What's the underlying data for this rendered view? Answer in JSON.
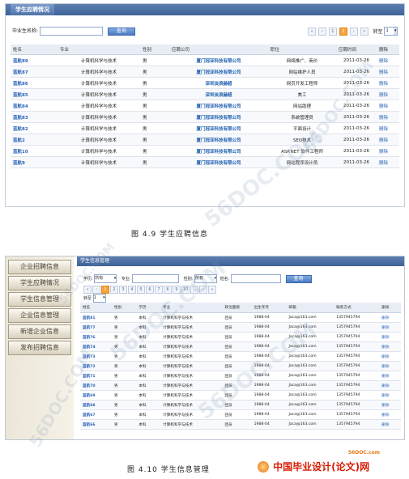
{
  "panel1": {
    "title": "学生应聘情况",
    "search_label": "毕业生名称:",
    "search_button": "查询",
    "pager": {
      "first": "«",
      "prev": "‹",
      "pages": [
        "1",
        "2"
      ],
      "current": "2",
      "next": "›",
      "last": "»",
      "goto_label": "转至",
      "goto_value": "1"
    },
    "columns": [
      "姓名",
      "专业",
      "性别",
      "应聘公司",
      "职位",
      "应聘时间",
      "删除"
    ],
    "rows": [
      [
        "蓝航89",
        "计算机科学与技术",
        "男",
        "厦门冠亚科技有限公司",
        "网络推广、商价",
        "2011-03-26",
        "删除"
      ],
      [
        "蓝航87",
        "计算机科学与技术",
        "男",
        "厦门冠亚科技有限公司",
        "网站维护人员",
        "2011-03-26",
        "删除"
      ],
      [
        "蓝航86",
        "计算机科学与技术",
        "男",
        "深圳淡浪赫超",
        "网页开发工程师",
        "2011-03-26",
        "删除"
      ],
      [
        "蓝航85",
        "计算机科学与技术",
        "男",
        "深圳淡浪赫超",
        "美工",
        "2011-03-26",
        "删除"
      ],
      [
        "蓝航84",
        "计算机科学与技术",
        "男",
        "厦门冠亚科技有限公司",
        "网站助理",
        "2011-03-26",
        "删除"
      ],
      [
        "蓝航83",
        "计算机科学与技术",
        "男",
        "厦门冠亚科技有限公司",
        "系统管理员",
        "2011-03-26",
        "删除"
      ],
      [
        "蓝航82",
        "计算机科学与技术",
        "男",
        "厦门冠亚科技有限公司",
        "平面设计",
        "2011-03-26",
        "删除"
      ],
      [
        "蓝航2",
        "计算机科学与技术",
        "男",
        "厦门冠亚科技有限公司",
        "SEO技术",
        "2011-03-26",
        "删除"
      ],
      [
        "蓝航10",
        "计算机科学与技术",
        "男",
        "厦门冠亚科技有限公司",
        "ASP.NET 软件工程师",
        "2011-03-26",
        "删除"
      ],
      [
        "蓝航9",
        "计算机科学与技术",
        "男",
        "厦门冠亚科技有限公司",
        "网站程序设计员",
        "2011-03-26",
        "删除"
      ]
    ]
  },
  "caption1": "图  4.9   学生应聘信息",
  "panel2": {
    "sidebar": [
      "企业招聘信息",
      "学生应聘情况",
      "学生信息管理",
      "企业信息管理",
      "新增企业信息",
      "发布招聘信息"
    ],
    "title": "学生信息管理",
    "filters": {
      "edu_label": "学历:",
      "edu_value": "所有",
      "major_label": "专业:",
      "gender_label": "性别:",
      "gender_value": "所有",
      "name_label": "姓名:",
      "search_button": "查询"
    },
    "pager": {
      "pages": [
        "1",
        "2",
        "3",
        "4",
        "5",
        "6",
        "7",
        "8",
        "9",
        "10"
      ],
      "current": "1",
      "more": "...",
      "goto_label": "转至",
      "goto_value": "1"
    },
    "columns": [
      "姓名",
      "性别",
      "学历",
      "专业",
      "政治面貌",
      "出生年月",
      "邮箱",
      "联系方式",
      "删除"
    ],
    "rows": [
      [
        "蓝航81",
        "男",
        "本科",
        "计算机科学与技术",
        "团员",
        "1988-04",
        "Jaca@163.com",
        "1357945794",
        "删除"
      ],
      [
        "蓝航77",
        "男",
        "本科",
        "计算机科学与技术",
        "团员",
        "1988-04",
        "Jaca@163.com",
        "1357945794",
        "删除"
      ],
      [
        "蓝航76",
        "男",
        "本科",
        "计算机科学与技术",
        "团员",
        "1988-04",
        "Jaca@163.com",
        "1357945794",
        "删除"
      ],
      [
        "蓝航74",
        "男",
        "本科",
        "计算机科学与技术",
        "团员",
        "1988-04",
        "Jaca@163.com",
        "1357945794",
        "删除"
      ],
      [
        "蓝航73",
        "男",
        "本科",
        "计算机科学与技术",
        "团员",
        "1988-04",
        "Jaca@163.com",
        "1357945794",
        "删除"
      ],
      [
        "蓝航72",
        "男",
        "本科",
        "计算机科学与技术",
        "团员",
        "1988-04",
        "Jaca@163.com",
        "1357945794",
        "删除"
      ],
      [
        "蓝航71",
        "男",
        "本科",
        "计算机科学与技术",
        "团员",
        "1988-04",
        "Jaca@163.com",
        "1357945794",
        "删除"
      ],
      [
        "蓝航70",
        "男",
        "本科",
        "计算机科学与技术",
        "团员",
        "1988-04",
        "Jaca@163.com",
        "1357945794",
        "删除"
      ],
      [
        "蓝航69",
        "男",
        "本科",
        "计算机科学与技术",
        "团员",
        "1988-04",
        "Jaca@163.com",
        "1357945794",
        "删除"
      ],
      [
        "蓝航68",
        "男",
        "本科",
        "计算机科学与技术",
        "团员",
        "1988-04",
        "Jaca@163.com",
        "1357945794",
        "删除"
      ],
      [
        "蓝航67",
        "男",
        "本科",
        "计算机科学与技术",
        "团员",
        "1988-04",
        "Jaca@163.com",
        "1357945794",
        "删除"
      ],
      [
        "蓝航66",
        "男",
        "本科",
        "计算机科学与技术",
        "团员",
        "1988-04",
        "Jaca@163.com",
        "1357945794",
        "删除"
      ]
    ]
  },
  "caption2": "图  4.10   学生信息管理",
  "watermarks": [
    "56DOC.COM",
    "56DOC.COM",
    "56DOC.COM",
    "56DOC.COM",
    "56DOC.COM",
    "56DOC.COM"
  ],
  "logo": {
    "site": "56DOC.com",
    "name": "中国毕业设计(论文)网"
  },
  "colors": {
    "header_blue": "#3e6298",
    "link_blue": "#2a63b8",
    "pager_current": "#f7a23a",
    "logo_red": "#d81e06"
  }
}
